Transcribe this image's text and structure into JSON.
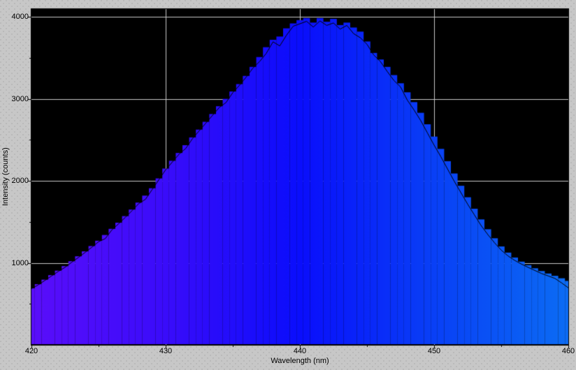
{
  "window": {
    "background_color": "#c7c7c7",
    "dither_dot_color": "#9b9b9b",
    "text_color": "#000000"
  },
  "chart_data": {
    "type": "area",
    "title": "",
    "xlabel": "Wavelength (nm)",
    "ylabel": "Intensity (counts)",
    "xlim": [
      420,
      460
    ],
    "ylim": [
      0,
      4095
    ],
    "x_major_ticks": [
      420,
      430,
      440,
      450,
      460
    ],
    "x_minor_ticks": [
      425,
      435,
      445,
      455
    ],
    "x_tick_labels": [
      "420",
      "430",
      "440",
      "450",
      "460"
    ],
    "y_major_ticks": [
      1000,
      2000,
      3000,
      4000
    ],
    "y_minor_ticks": [
      500,
      1500,
      2500,
      3500
    ],
    "y_tick_labels": [
      "1000",
      "2000",
      "3000",
      "4000"
    ],
    "grid": {
      "color": "#c9c9c9",
      "x_lines": [
        430,
        440,
        450
      ],
      "y_lines": [
        1000,
        2000,
        3000,
        4000
      ]
    },
    "plot_bg": "#000000",
    "axis_color": "#000000",
    "legend": "none",
    "x_start": 420,
    "x_step": 0.5,
    "gradient_stops": [
      {
        "pos": 0.0,
        "color": "#5a0efa"
      },
      {
        "pos": 0.25,
        "color": "#3a0cfa"
      },
      {
        "pos": 0.5,
        "color": "#0a0efc"
      },
      {
        "pos": 0.75,
        "color": "#0940f6"
      },
      {
        "pos": 1.0,
        "color": "#0c6cf4"
      }
    ],
    "series": [
      {
        "name": "spectrum-max-fill",
        "style": "filled-steps",
        "fill": "wavelength-gradient",
        "values": [
          690,
          740,
          795,
          850,
          905,
          960,
          1020,
          1080,
          1140,
          1205,
          1270,
          1340,
          1415,
          1490,
          1570,
          1650,
          1735,
          1820,
          1910,
          2030,
          2150,
          2245,
          2340,
          2435,
          2530,
          2625,
          2720,
          2815,
          2910,
          3000,
          3090,
          3180,
          3280,
          3390,
          3510,
          3630,
          3720,
          3760,
          3860,
          3920,
          3960,
          3985,
          3930,
          3985,
          3940,
          3975,
          3900,
          3930,
          3870,
          3820,
          3700,
          3560,
          3480,
          3390,
          3290,
          3190,
          3080,
          2960,
          2830,
          2690,
          2540,
          2390,
          2240,
          2090,
          1940,
          1800,
          1660,
          1530,
          1410,
          1300,
          1200,
          1125,
          1065,
          1015,
          972,
          934,
          900,
          870,
          842,
          812,
          780
        ]
      },
      {
        "name": "spectrum-trace-line",
        "style": "line",
        "color": "#000000",
        "values": [
          690,
          735,
          790,
          845,
          900,
          950,
          1012,
          1070,
          1132,
          1195,
          1262,
          1300,
          1408,
          1482,
          1560,
          1642,
          1728,
          1780,
          1900,
          2020,
          2140,
          2235,
          2330,
          2400,
          2520,
          2615,
          2710,
          2805,
          2900,
          2960,
          3080,
          3170,
          3270,
          3380,
          3460,
          3560,
          3700,
          3650,
          3780,
          3890,
          3920,
          3950,
          3880,
          3955,
          3900,
          3930,
          3855,
          3900,
          3800,
          3750,
          3670,
          3540,
          3460,
          3340,
          3230,
          3150,
          2990,
          2870,
          2740,
          2590,
          2440,
          2300,
          2150,
          2000,
          1860,
          1720,
          1590,
          1460,
          1350,
          1250,
          1160,
          1090,
          1035,
          990,
          950,
          912,
          875,
          845,
          815,
          760,
          700
        ]
      }
    ]
  }
}
